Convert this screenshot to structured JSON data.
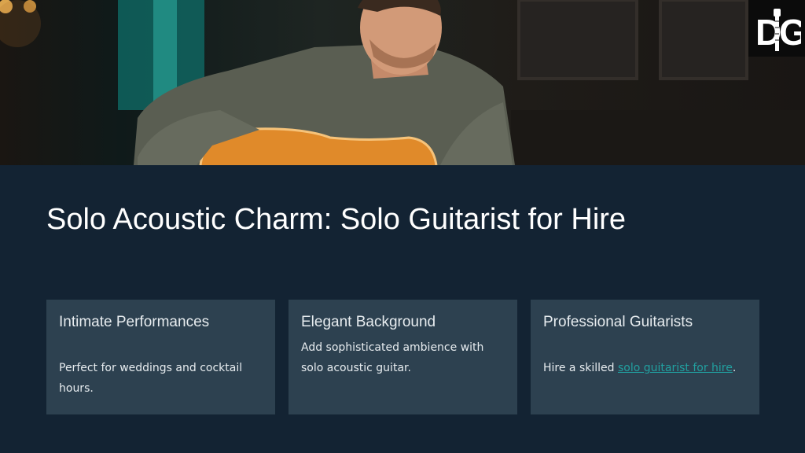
{
  "hero": {
    "image": "man-playing-acoustic-guitar-photo"
  },
  "logo": {
    "text": "DIG",
    "icon": "guitar-neck-logo"
  },
  "title": "Solo Acoustic Charm: Solo Guitarist for Hire",
  "cards": [
    {
      "heading": "Intimate Performances",
      "body": "Perfect for weddings and cocktail hours."
    },
    {
      "heading": "Elegant Background",
      "body": "Add sophisticated ambience with solo acoustic guitar."
    },
    {
      "heading": "Professional Guitarists",
      "body_prefix": "Hire a skilled ",
      "link_text": "solo guitarist for hire",
      "body_suffix": "."
    }
  ],
  "colors": {
    "background": "#132333",
    "card": "#2d4150",
    "link": "#21a0a0",
    "title": "#ffffff"
  }
}
